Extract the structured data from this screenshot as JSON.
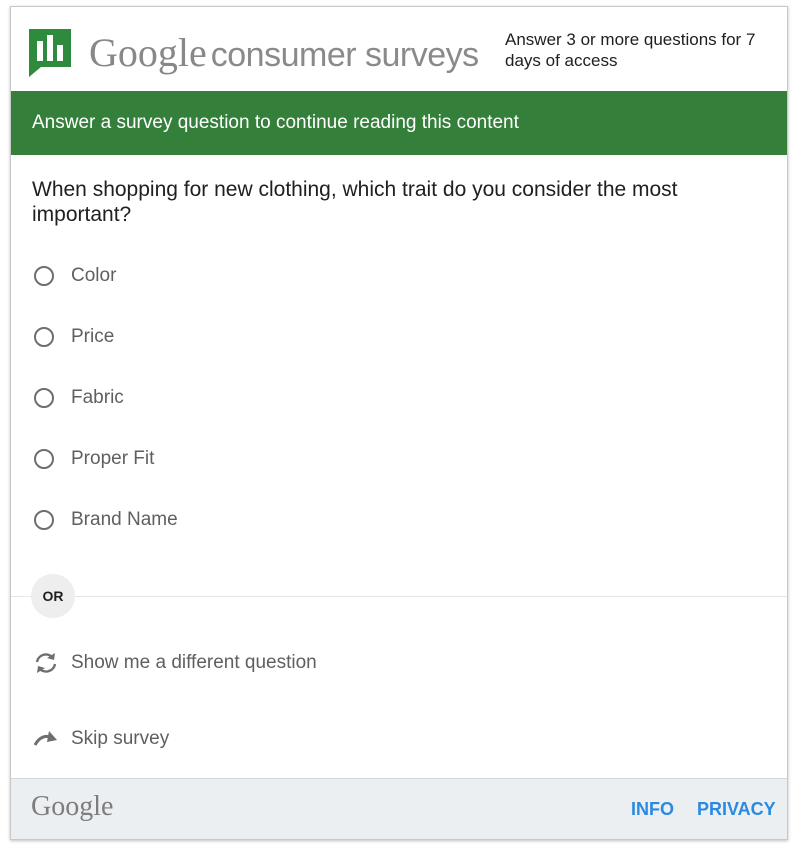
{
  "header": {
    "brand_google": "Google",
    "brand_product": "consumer surveys",
    "access_note": "Answer 3 or more questions for 7 days of access",
    "logo_icon": "bar-chart-flag-icon"
  },
  "banner": {
    "text": "Answer a survey question to continue reading this content"
  },
  "survey": {
    "question": "When shopping for new clothing, which trait do you consider the most important?",
    "options": [
      {
        "label": "Color"
      },
      {
        "label": "Price"
      },
      {
        "label": "Fabric"
      },
      {
        "label": "Proper Fit"
      },
      {
        "label": "Brand Name"
      }
    ]
  },
  "divider": {
    "or_label": "OR"
  },
  "actions": {
    "different_question": {
      "label": "Show me a different question",
      "icon": "refresh-icon"
    },
    "skip": {
      "label": "Skip survey",
      "icon": "skip-arrow-icon"
    }
  },
  "footer": {
    "logo": "Google",
    "info_link": "INFO",
    "privacy_link": "PRIVACY"
  },
  "colors": {
    "banner_green": "#34803a",
    "logo_green": "#2e8b3e",
    "link_blue": "#2a8ae0",
    "footer_bg": "#eceff2"
  }
}
